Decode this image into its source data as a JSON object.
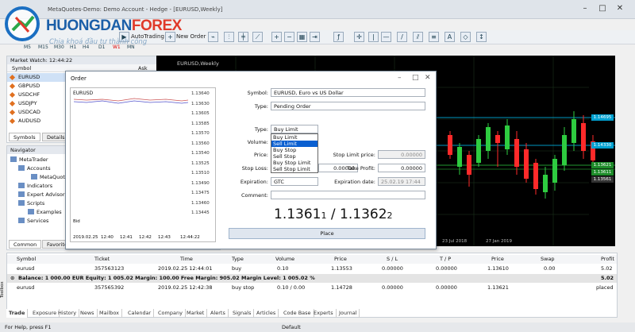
{
  "window": {
    "title": "MetaQuotes-Demo: Demo Account - Hedge - [EURUSD,Weekly]"
  },
  "logo": {
    "brand_a": "HUONGDAN",
    "brand_b": "FOREX",
    "tagline": "Chia khoá đầu tư thành công"
  },
  "toolbar": {
    "autotrading": "AutoTrading",
    "new_order": "New Order"
  },
  "timeframes": [
    "M5",
    "M15",
    "M30",
    "H1",
    "H4",
    "D1",
    "W1",
    "MN"
  ],
  "market_watch": {
    "title": "Market Watch: 12:44:22",
    "col_symbol": "Symbol",
    "col_ask": "Ask",
    "symbols": [
      "EURUSD",
      "GBPUSD",
      "USDCHF",
      "USDJPY",
      "USDCAD",
      "AUDUSD"
    ],
    "tabs": [
      "Symbols",
      "Details"
    ]
  },
  "navigator": {
    "title": "Navigator",
    "items": [
      "MetaTrader",
      "Accounts",
      "MetaQuot",
      "Indicators",
      "Expert Advisors",
      "Scripts",
      "Examples",
      "Services"
    ],
    "tabs": [
      "Common",
      "Favorites"
    ]
  },
  "chart": {
    "caption": "EURUSD,Weekly",
    "price_labels": [
      "1.14695",
      "1.14330",
      "1.13621",
      "1.13611",
      "1.13561"
    ],
    "x_labels": [
      "23 Jul 2018",
      "27 Jan 2019"
    ]
  },
  "dialog": {
    "title": "Order",
    "mini_symbol": "EURUSD",
    "mini_prices": [
      "1.13640",
      "1.13630",
      "1.13605",
      "1.13585",
      "1.13570",
      "1.13560",
      "1.13540",
      "1.13525",
      "1.13510",
      "1.13490",
      "1.13475",
      "1.13460",
      "1.13445"
    ],
    "mini_times": [
      "2019.02.25",
      "12:40",
      "12:41",
      "12:42",
      "12:43",
      "12:44:22"
    ],
    "mini_bid": "Bid",
    "symbol_label": "Symbol:",
    "symbol_value": "EURUSD, Euro vs US Dollar",
    "type_label": "Type:",
    "type_value": "Pending Order",
    "order_type_label": "Type:",
    "order_type_value": "Buy Limit",
    "dropdown": [
      "Buy Limit",
      "Sell Limit",
      "Buy Stop",
      "Sell Stop",
      "Buy Stop Limit",
      "Sell Stop Limit"
    ],
    "volume_label": "Volume:",
    "price_label": "Price:",
    "sl_label": "Stop Loss:",
    "tp_label": "Take Profit:",
    "stop_limit_label": "Stop Limit price:",
    "stop_limit_value": "0.00000",
    "sl_value": "0.00000",
    "tp_value": "0.00000",
    "expiration_label": "Expiration:",
    "expiration_value": "GTC",
    "exp_date_label": "Expiration date:",
    "exp_date_value": "25.02.19 17:44",
    "comment_label": "Comment:",
    "bid_price": "1.1361",
    "bid_small": "1",
    "ask_price": "1.1362",
    "ask_small": "2",
    "separator": "/",
    "place_button": "Place"
  },
  "terminal": {
    "headers": [
      "Symbol",
      "Ticket",
      "Time",
      "Type",
      "Volume",
      "Price",
      "S / L",
      "T / P",
      "Price",
      "Swap",
      "Profit"
    ],
    "rows": [
      [
        "eurusd",
        "357563123",
        "2019.02.25 12:44:01",
        "buy",
        "0.10",
        "1.13553",
        "0.00000",
        "0.00000",
        "1.13610",
        "0.00",
        "5.02"
      ],
      [
        "eurusd",
        "357565392",
        "2019.02.25 12:42:38",
        "buy stop",
        "0.10 / 0.00",
        "1.14728",
        "0.00000",
        "0.00000",
        "1.13621",
        "",
        "placed"
      ]
    ],
    "balance": "Balance: 1 000.00 EUR  Equity: 1 005.02  Margin: 100.00  Free Margin: 905.02  Margin Level: 1 005.02 %",
    "balance_profit": "5.02",
    "tabs": [
      "Trade",
      "Exposure",
      "History",
      "News",
      "Mailbox",
      "Calendar",
      "Company",
      "Market",
      "Alerts",
      "Signals",
      "Articles",
      "Code Base",
      "Experts",
      "Journal"
    ],
    "side_label": "Toolbox"
  },
  "status": {
    "help": "For Help, press F1",
    "profile": "Default"
  },
  "colors": {
    "bull": "#2ecc40",
    "bear": "#ff2a2a",
    "chart_bg": "#000000"
  }
}
